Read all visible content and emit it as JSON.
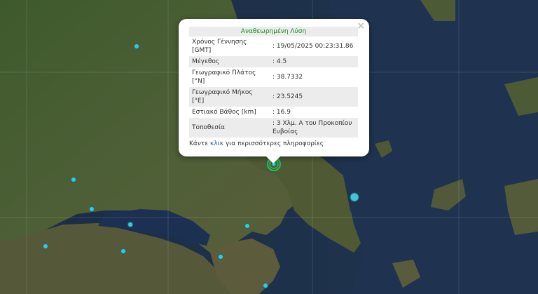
{
  "popup": {
    "title": "Αναθεωρημένη Λύση",
    "close_glyph": "×",
    "rows": [
      {
        "label": "Χρόνος Γέννησης [GMT]",
        "value": ": 19/05/2025 00:23:31.86"
      },
      {
        "label": "Μέγεθος",
        "value": ": 4.5"
      },
      {
        "label": "Γεωγραφικό Πλάτος [°N]",
        "value": ": 38.7332"
      },
      {
        "label": "Γεωγραφικό Μήκος [°E]",
        "value": ": 23.5245"
      },
      {
        "label": "Εστιακό Βάθος [km]",
        "value": ": 16.9"
      },
      {
        "label": "Τοποθεσία",
        "value": ": 3 Χλμ. Α του Προκοπίου Ευβοίας"
      }
    ],
    "footer": {
      "prefix": "Κάντε ",
      "link": "κλικ",
      "suffix": " για περισσότερες πληροφορίες"
    }
  },
  "colors": {
    "accent_title": "#1a8a1a",
    "link": "#1a5fb4",
    "marker_fill": "#3fc6d6",
    "selected_marker": "#1fbf5a"
  },
  "markers": [
    {
      "name": "earthquake-marker"
    },
    {
      "name": "earthquake-marker"
    },
    {
      "name": "earthquake-marker"
    },
    {
      "name": "earthquake-marker"
    },
    {
      "name": "earthquake-marker"
    },
    {
      "name": "earthquake-marker"
    },
    {
      "name": "earthquake-marker"
    },
    {
      "name": "earthquake-marker"
    },
    {
      "name": "earthquake-marker"
    }
  ]
}
